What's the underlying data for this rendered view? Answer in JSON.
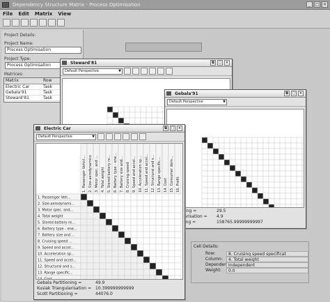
{
  "app": {
    "title": "Dependency Structure Matrix - Process Optimisation",
    "controls": [
      "_",
      "□",
      "×"
    ]
  },
  "menu": [
    "File",
    "Edit",
    "Matrix",
    "View"
  ],
  "left": {
    "project_details": "Project Details:",
    "name_label": "Project Name:",
    "name_value": "Process Optimisation",
    "type_label": "Project Type:",
    "type_value": "Process Optimisation",
    "matrices_label": "Matrices:",
    "col_matrix": "Matrix",
    "col_row": "Row",
    "rows": [
      {
        "matrix": "Electric Car",
        "row": "Task"
      },
      {
        "matrix": "Gebala'91",
        "row": "Task"
      },
      {
        "matrix": "Steward'81",
        "row": "Task"
      }
    ]
  },
  "windows": {
    "steward": {
      "title": "Steward'81",
      "perspective": "Default Perspective"
    },
    "gebala": {
      "title": "Gebala'91",
      "perspective": "Default Perspective",
      "stats": [
        "Partitioning =",
        "…ranguarisation =",
        "…rtitioning ="
      ],
      "stat_values": [
        "29.5",
        "4.9",
        "158765.99999999997"
      ]
    },
    "electric": {
      "title": "Electric Car",
      "perspective": "Default Perspective",
      "rows": [
        "1. Passenger Veh...",
        "2. Size-aerodynami...",
        "3. Motor spec. and...",
        "4. Total weight",
        "5. Stored battery re...",
        "6. Battery type - ene...",
        "7. Battery size and ...",
        "8. Cruising speed ...",
        "9. Speed and accel...",
        "10. Acceleration sp...",
        "11. Speed and accel...",
        "12. Structural and s...",
        "13. Range specific...",
        "14. Cost",
        "15. Consumer de..."
      ],
      "cols": [
        "Passenger Vehicl...",
        "Size-aerodynamics",
        "Motor spec. and ...",
        "Total weight",
        "Stored battery re...",
        "Battery type - ene...",
        "Battery size and...",
        "Cruising speed",
        "Speed and accel...",
        "Acceleration sp...",
        "Speed and accel...",
        "Structural and s...",
        "Range specific...",
        "Cost",
        "Consumer dem...",
        "Profit"
      ],
      "stats": [
        "Gebala Partitioning =",
        "Kusiak Triangularisation =",
        "Scott Partitioning ="
      ],
      "stat_values": [
        "49.9",
        "10.399999999999",
        "44076.0"
      ]
    }
  },
  "cell_details": {
    "title": "Cell Details:",
    "rows": [
      {
        "k": "Row:",
        "v": "8. Cruising speed specificat"
      },
      {
        "k": "Column:",
        "v": "4. Total weight"
      },
      {
        "k": "Dependency:",
        "v": "Independent"
      },
      {
        "k": "Weight:",
        "v": "0.0"
      }
    ]
  }
}
